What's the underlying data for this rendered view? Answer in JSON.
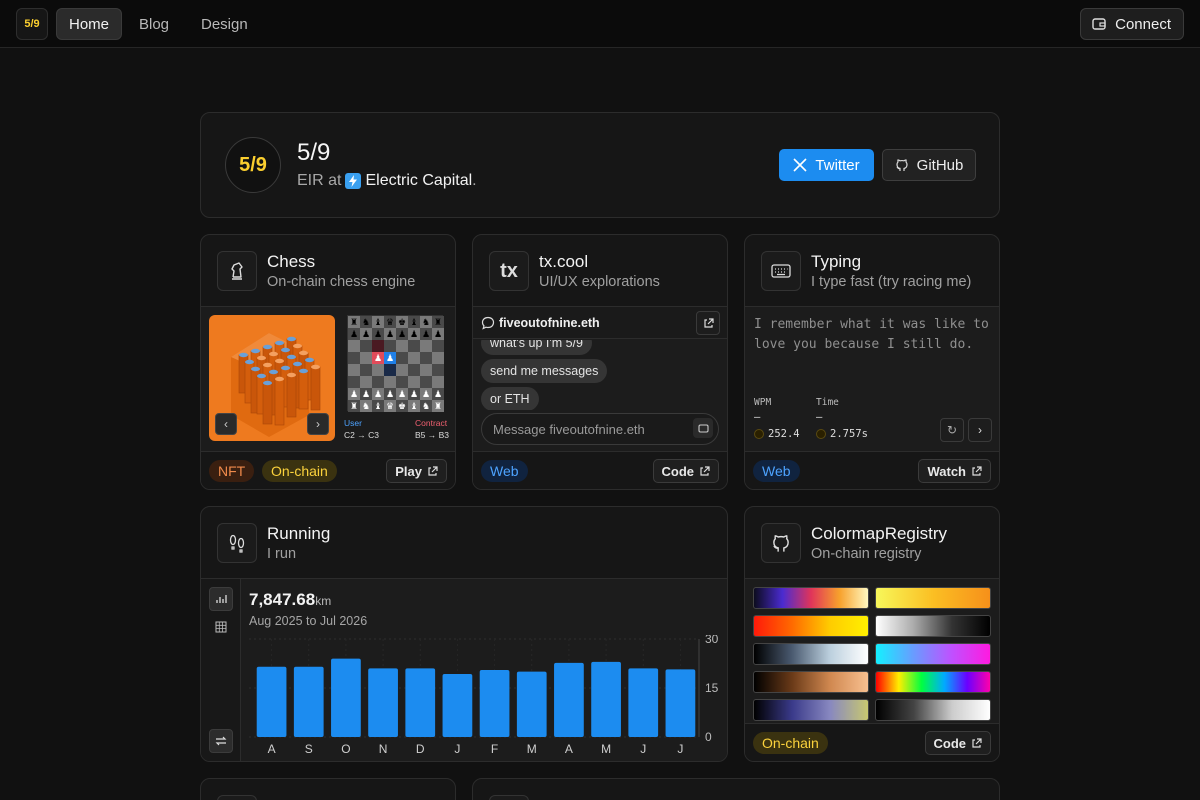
{
  "nav": {
    "logo": "5/9",
    "links": [
      "Home",
      "Blog",
      "Design"
    ],
    "connect_label": "Connect"
  },
  "profile": {
    "avatar_text": "5/9",
    "name": "5/9",
    "role_prefix": "EIR at",
    "company": "Electric Capital",
    "role_suffix": ".",
    "twitter_label": "Twitter",
    "github_label": "GitHub",
    "twitter_color": "#1c8cf0"
  },
  "chess": {
    "title": "Chess",
    "subtitle": "On-chain chess engine",
    "user_label": "User",
    "user_move": "C2 → C3",
    "contract_label": "Contract",
    "contract_move": "B5 → B3",
    "tags": [
      "NFT",
      "On-chain"
    ],
    "button": "Play",
    "nft_color": "#ee7a1f",
    "prev_icon": "chevron-left-icon",
    "next_icon": "chevron-right-icon"
  },
  "txcool": {
    "title": "tx.cool",
    "subtitle": "UI/UX explorations",
    "icon_text": "tx",
    "chat_name": "fiveoutofnine.eth",
    "messages": [
      "what's up I'm 5/9",
      "send me messages",
      "or ETH"
    ],
    "input_placeholder": "Message fiveoutofnine.eth",
    "tags": [
      "Web"
    ],
    "button": "Code"
  },
  "typing": {
    "title": "Typing",
    "subtitle": "I type fast (try racing me)",
    "text": "I remember what it was like to love you because I still do.",
    "wpm_label": "WPM",
    "time_label": "Time",
    "wpm_current": "–",
    "time_current": "–",
    "wpm_best": "252.4",
    "time_best": "2.757s",
    "tags": [
      "Web"
    ],
    "button": "Watch"
  },
  "running": {
    "title": "Running",
    "subtitle": "I run",
    "total": "7,847.68",
    "unit": "km",
    "range": "Aug 2025 to Jul 2026"
  },
  "colormap": {
    "title": "ColormapRegistry",
    "subtitle": "On-chain registry",
    "tags": [
      "On-chain"
    ],
    "button": "Code",
    "gradients": [
      "linear-gradient(90deg,#0c0c1e,#4a2bd0,#e0345a,#f7a12c,#fff8c0)",
      "linear-gradient(90deg,#f7f75a,#fbbf23,#f6901a)",
      "linear-gradient(90deg,#ff1a0a,#ff6a00,#ffcc00,#fff000)",
      "linear-gradient(90deg,#ffffff,#aaaaaa,#333333,#000000)",
      "linear-gradient(90deg,#000000,#4a5a70,#bcd0de,#ffffff)",
      "linear-gradient(90deg,#14f0ff,#6a9bff,#c050ff,#ff1ae0)",
      "linear-gradient(90deg,#000000,#6a3a18,#d08850,#f8c090)",
      "linear-gradient(90deg,#ff0000,#ffee00,#00ff40,#00aaff,#6a00ff,#ff00aa)",
      "linear-gradient(90deg,#000000,#3a3a8a,#8888c0,#c8c870)",
      "linear-gradient(90deg,#000000,#444444,#cccccc,#ffffff)"
    ]
  },
  "chart_data": {
    "type": "bar",
    "categories": [
      "A",
      "S",
      "O",
      "N",
      "D",
      "J",
      "F",
      "M",
      "A",
      "M",
      "J",
      "J"
    ],
    "values": [
      21.5,
      21.5,
      24,
      21,
      21,
      19.3,
      20.5,
      20,
      22.7,
      23,
      21,
      20.7
    ],
    "ylim": [
      0,
      30
    ],
    "yticks": [
      "30",
      "15",
      "0"
    ],
    "bar_color": "#1c8cf0",
    "grid": true
  }
}
